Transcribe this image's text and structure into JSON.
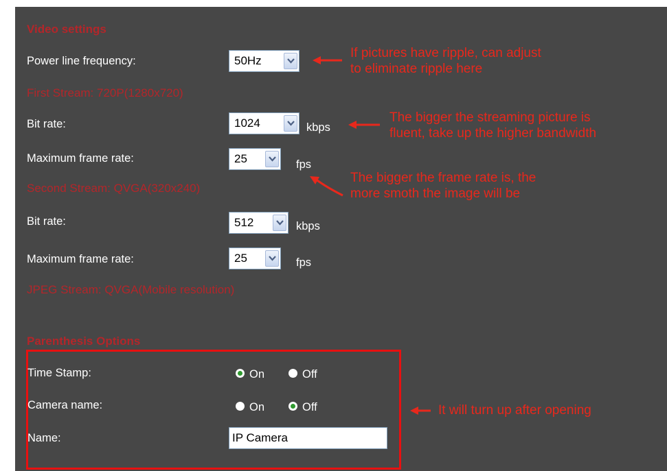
{
  "video_settings": {
    "title": "Video settings",
    "power_line": {
      "label": "Power line frequency:",
      "value": "50Hz"
    }
  },
  "first_stream": {
    "title": "First Stream: 720P(1280x720)",
    "bit_rate": {
      "label": "Bit rate:",
      "value": "1024",
      "unit": "kbps"
    },
    "frame_rate": {
      "label": "Maximum frame rate:",
      "value": "25",
      "unit": "fps"
    }
  },
  "second_stream": {
    "title": "Second Stream: QVGA(320x240)",
    "bit_rate": {
      "label": "Bit rate:",
      "value": "512",
      "unit": "kbps"
    },
    "frame_rate": {
      "label": "Maximum frame rate:",
      "value": "25",
      "unit": "fps"
    }
  },
  "jpeg_stream": {
    "title": "JPEG Stream: QVGA(Mobile resolution)"
  },
  "parenthesis_options": {
    "title": "Parenthesis Options",
    "time_stamp": {
      "label": "Time Stamp:",
      "on": "On",
      "off": "Off",
      "selected": "On"
    },
    "camera_name": {
      "label": "Camera name:",
      "on": "On",
      "off": "Off",
      "selected": "Off"
    },
    "name": {
      "label": "Name:",
      "value": "IP Camera"
    }
  },
  "annotations": {
    "ripple": "If pictures have ripple, can adjust\nto eliminate ripple here",
    "bitrate": "The bigger the streaming picture is\nfluent, take up the higher bandwidth",
    "framerate": "The bigger the frame rate is, the\nmore smoth the image will be",
    "opening": "It will turn up after opening"
  },
  "colors": {
    "panel_bg": "#474747",
    "section_title": "#b3262a",
    "annotation": "#e8281c",
    "highlight_box": "#e81010",
    "radio_checked": "#2f9a2f"
  },
  "icons": [
    "chevron-down-icon",
    "arrow-left-icon",
    "arrow-curved-icon"
  ]
}
